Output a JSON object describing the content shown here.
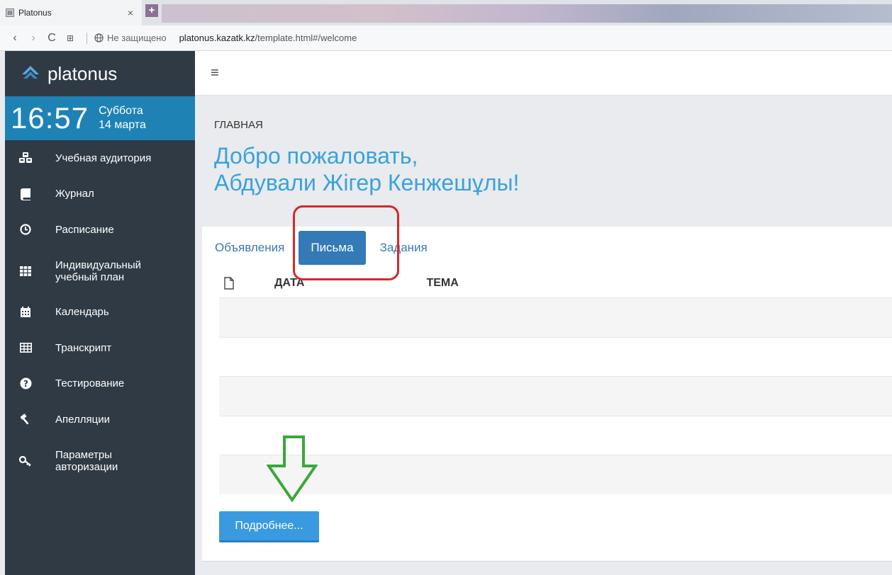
{
  "browser": {
    "tab_title": "Platonus",
    "tab_close": "×",
    "new_tab": "+",
    "security_note": "Не защищено",
    "url_domain": "platonus.kazatk.kz",
    "url_path": "/template.html#/welcome"
  },
  "sidebar": {
    "brand": "platonus",
    "clock": {
      "time": "16:57",
      "weekday": "Суббота",
      "date": "14 марта"
    },
    "items": [
      {
        "label": "Учебная аудитория",
        "icon": "cubes-icon"
      },
      {
        "label": "Журнал",
        "icon": "book-icon"
      },
      {
        "label": "Расписание",
        "icon": "clock-icon"
      },
      {
        "label_line1": "Индивидуальный",
        "label_line2": "учебный план",
        "icon": "grid-icon"
      },
      {
        "label": "Календарь",
        "icon": "calendar-icon"
      },
      {
        "label": "Транскрипт",
        "icon": "table-icon"
      },
      {
        "label": "Тестирование",
        "icon": "question-icon"
      },
      {
        "label": "Апелляции",
        "icon": "gavel-icon"
      },
      {
        "label_line1": "Параметры",
        "label_line2": "авторизации",
        "icon": "key-icon"
      }
    ]
  },
  "header": {
    "breadcrumb": "ГЛАВНАЯ",
    "welcome_line1": "Добро пожаловать,",
    "welcome_line2": "Абдували Жігер Кенжешұлы!"
  },
  "content": {
    "tabs": [
      "Объявления",
      "Письма",
      "Задания"
    ],
    "active_tab": "Письма",
    "columns": {
      "date": "ДАТА",
      "subject": "ТЕМА"
    },
    "more_button": "Подробнее..."
  },
  "colors": {
    "sidebar": "#2f3a45",
    "clock_bg": "#1f82b5",
    "accent": "#3aa2de",
    "active_tab": "#337ab7",
    "annotation_red": "#d42a2a",
    "annotation_green": "#3aa83a"
  }
}
